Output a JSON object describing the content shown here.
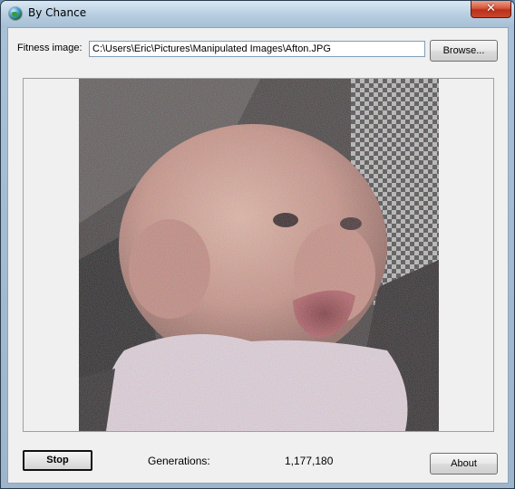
{
  "window": {
    "title": "By Chance",
    "close_glyph": "✕"
  },
  "fitness": {
    "label": "Fitness image:",
    "path": "C:\\Users\\Eric\\Pictures\\Manipulated Images\\Afton.JPG",
    "browse_label": "Browse..."
  },
  "controls": {
    "stop_label": "Stop",
    "about_label": "About"
  },
  "status": {
    "generations_label": "Generations:",
    "generations_value": "1,177,180"
  },
  "icons": {
    "app": "globe-icon",
    "close": "close-icon"
  },
  "colors": {
    "client_bg": "#f0f0f0",
    "close_button": "#c9472c",
    "title_bar": "#b7cde0"
  }
}
